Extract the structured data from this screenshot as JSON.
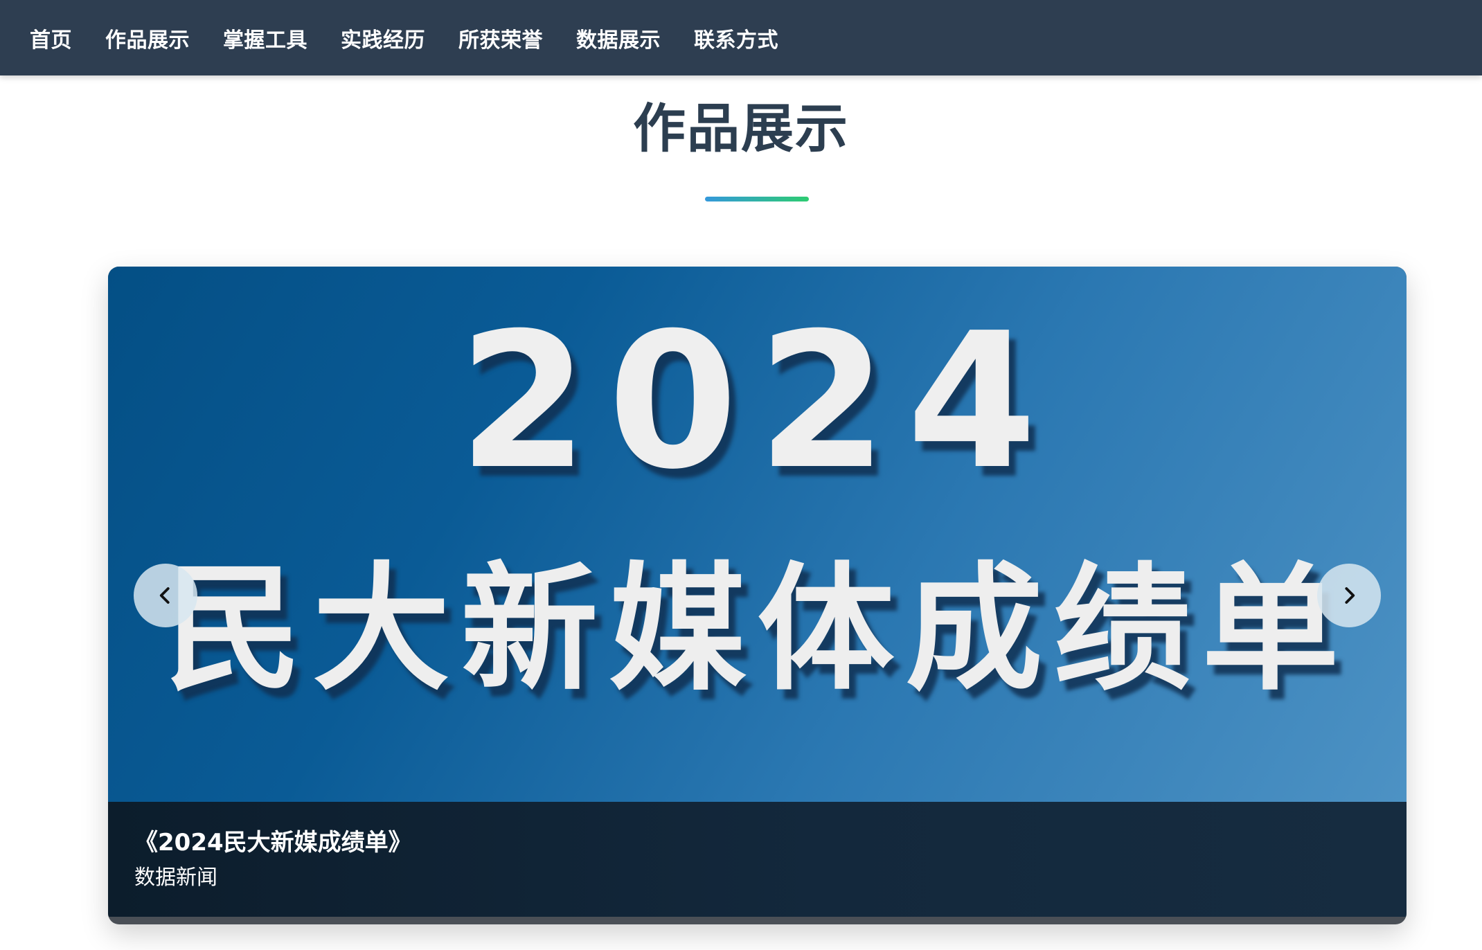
{
  "nav": {
    "items": [
      {
        "label": "首页"
      },
      {
        "label": "作品展示"
      },
      {
        "label": "掌握工具"
      },
      {
        "label": "实践经历"
      },
      {
        "label": "所获荣誉"
      },
      {
        "label": "数据展示"
      },
      {
        "label": "联系方式"
      }
    ]
  },
  "section": {
    "title": "作品展示"
  },
  "carousel": {
    "slide": {
      "image_year": "2024",
      "image_headline": "民大新媒体成绩单",
      "caption_title": "《2024民大新媒成绩单》",
      "caption_category": "数据新闻"
    }
  },
  "icons": {
    "prev": "chevron-left-icon",
    "next": "chevron-right-icon"
  },
  "colors": {
    "navbar_bg": "#2e3e51",
    "title_text": "#2c3e50",
    "underline_start": "#3498db",
    "underline_end": "#2ecc71",
    "slide_blue": "#0a5b96",
    "caption_bg": "#13283c"
  }
}
